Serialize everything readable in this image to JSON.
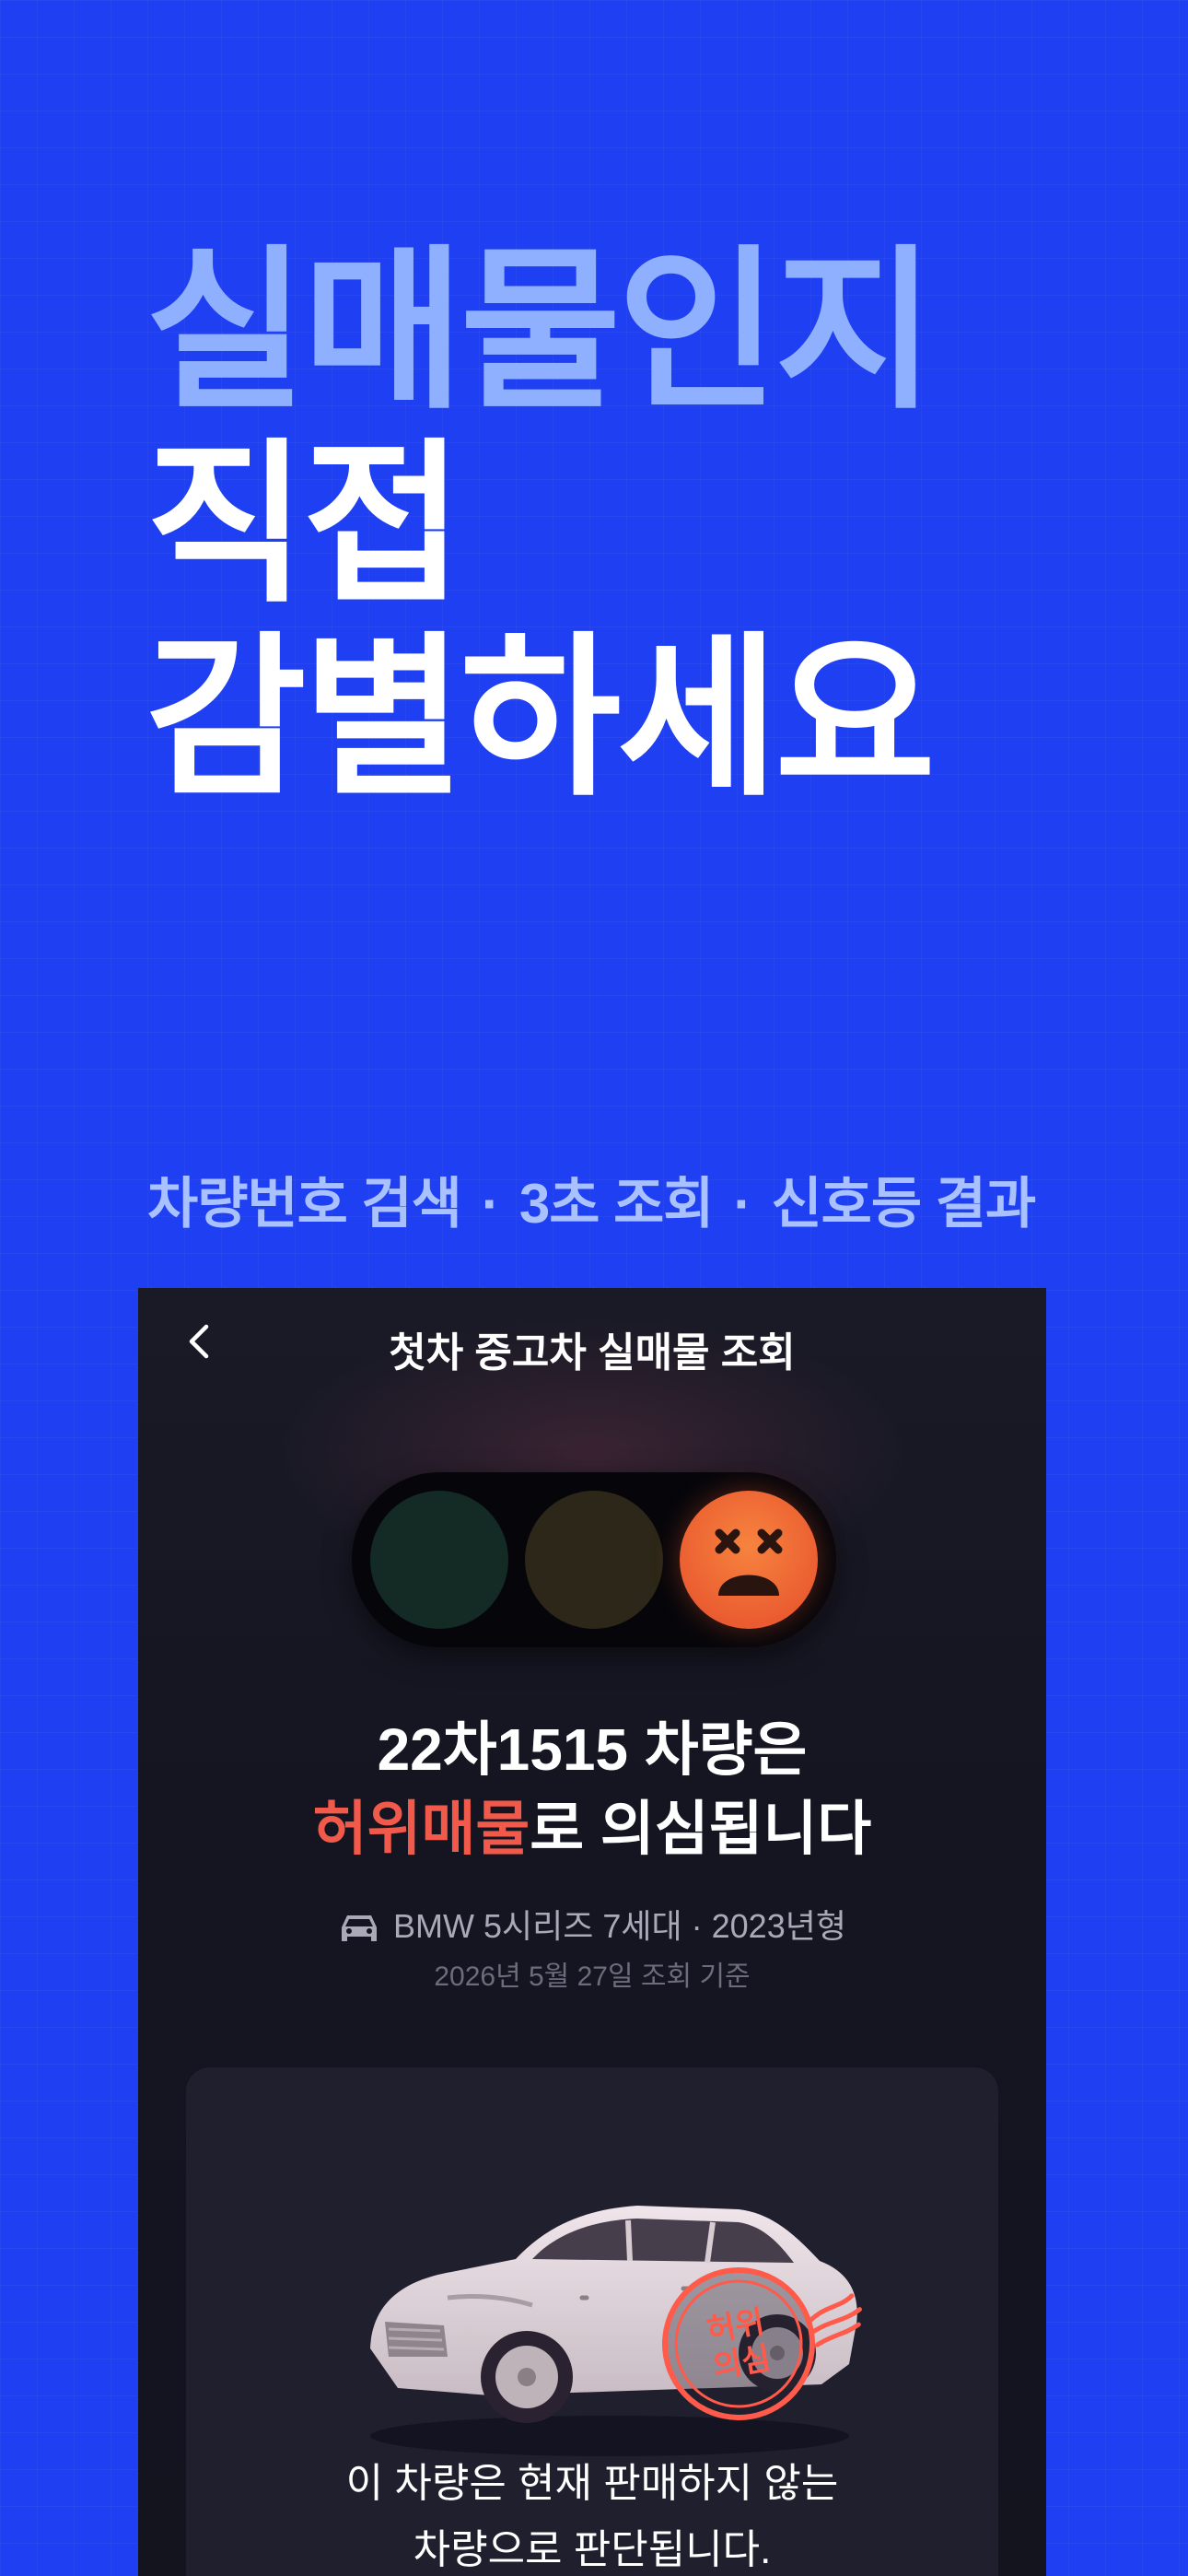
{
  "hero": {
    "line1": "실매물인지",
    "line2": "직접",
    "line3": "감별하세요"
  },
  "features": {
    "item1": "차량번호 검색",
    "item2": "3초 조회",
    "item3": "신호등 결과",
    "separator": "·"
  },
  "app": {
    "nav_title": "첫차 중고차 실매물 조회",
    "traffic_light": {
      "active": "red",
      "face": "dizzy-face-icon"
    },
    "plate": "22차1515 차량은",
    "verdict_highlight": "허위매물",
    "verdict_rest": "로 의심됩니다",
    "vehicle": "BMW 5시리즈 7세대 · 2023년형",
    "date": "2026년 5월 27일 조회 기준",
    "stamp_line1": "허위",
    "stamp_line2": "의심",
    "note_line1": "이 차량은 현재 판매하지 않는",
    "note_line2": "차량으로 판단됩니다."
  },
  "colors": {
    "background": "#1f3ff2",
    "accent_light": "#8fb0ff",
    "warning_red": "#f15a4a",
    "lamp_red": "#f07c3c"
  }
}
